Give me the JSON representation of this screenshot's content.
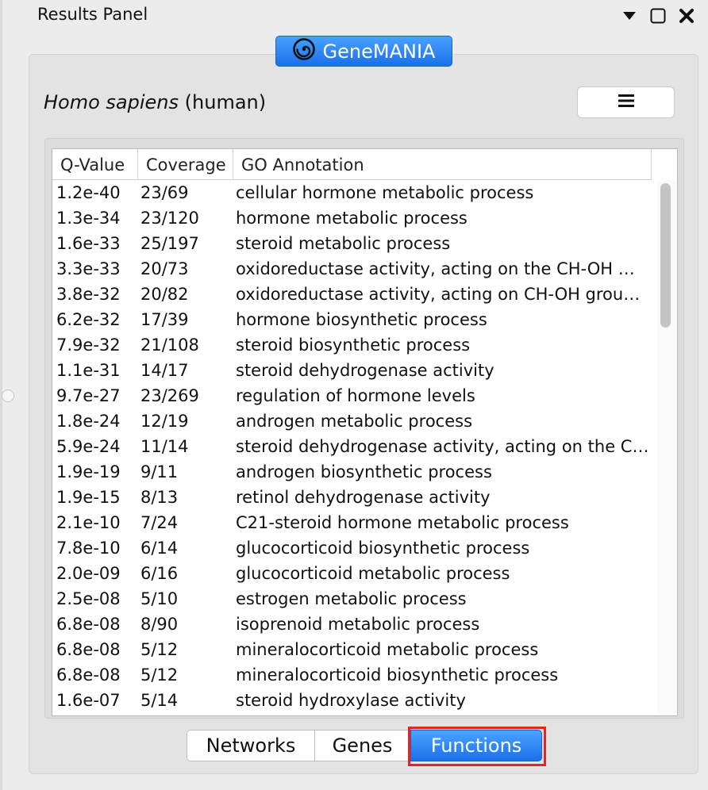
{
  "panel": {
    "title": "Results Panel"
  },
  "window_controls": [
    {
      "icon": "dropdown-arrow-icon"
    },
    {
      "icon": "maximize-icon"
    },
    {
      "icon": "close-icon"
    }
  ],
  "app": {
    "name": "GeneMANIA",
    "logo_icon": "spiral-logo-icon",
    "accent": "#2d86f5"
  },
  "organism": {
    "scientific": "Homo sapiens",
    "common": "(human)"
  },
  "menu": {
    "icon": "hamburger-menu-icon"
  },
  "table": {
    "columns": [
      "Q-Value",
      "Coverage",
      "GO Annotation"
    ],
    "rows": [
      [
        "1.2e-40",
        "23/69",
        "cellular hormone metabolic process"
      ],
      [
        "1.3e-34",
        "23/120",
        "hormone metabolic process"
      ],
      [
        "1.6e-33",
        "25/197",
        "steroid metabolic process"
      ],
      [
        "3.3e-33",
        "20/73",
        "oxidoreductase activity, acting on the CH-OH …"
      ],
      [
        "3.8e-32",
        "20/82",
        "oxidoreductase activity, acting on CH-OH grou…"
      ],
      [
        "6.2e-32",
        "17/39",
        "hormone biosynthetic process"
      ],
      [
        "7.9e-32",
        "21/108",
        "steroid biosynthetic process"
      ],
      [
        "1.1e-31",
        "14/17",
        "steroid dehydrogenase activity"
      ],
      [
        "9.7e-27",
        "23/269",
        "regulation of hormone levels"
      ],
      [
        "1.8e-24",
        "12/19",
        "androgen metabolic process"
      ],
      [
        "5.9e-24",
        "11/14",
        "steroid dehydrogenase activity, acting on the C…"
      ],
      [
        "1.9e-19",
        "9/11",
        "androgen biosynthetic process"
      ],
      [
        "1.9e-15",
        "8/13",
        "retinol dehydrogenase activity"
      ],
      [
        "2.1e-10",
        "7/24",
        "C21-steroid hormone metabolic process"
      ],
      [
        "7.8e-10",
        "6/14",
        "glucocorticoid biosynthetic process"
      ],
      [
        "2.0e-09",
        "6/16",
        "glucocorticoid metabolic process"
      ],
      [
        "2.5e-08",
        "5/10",
        "estrogen metabolic process"
      ],
      [
        "6.8e-08",
        "8/90",
        "isoprenoid metabolic process"
      ],
      [
        "6.8e-08",
        "5/12",
        "mineralocorticoid metabolic process"
      ],
      [
        "6.8e-08",
        "5/12",
        "mineralocorticoid biosynthetic process"
      ],
      [
        "1.6e-07",
        "5/14",
        "steroid hydroxylase activity"
      ]
    ]
  },
  "tabs": [
    {
      "label": "Networks",
      "selected": false
    },
    {
      "label": "Genes",
      "selected": false
    },
    {
      "label": "Functions",
      "selected": true
    }
  ],
  "highlight_color": "#e5261f"
}
